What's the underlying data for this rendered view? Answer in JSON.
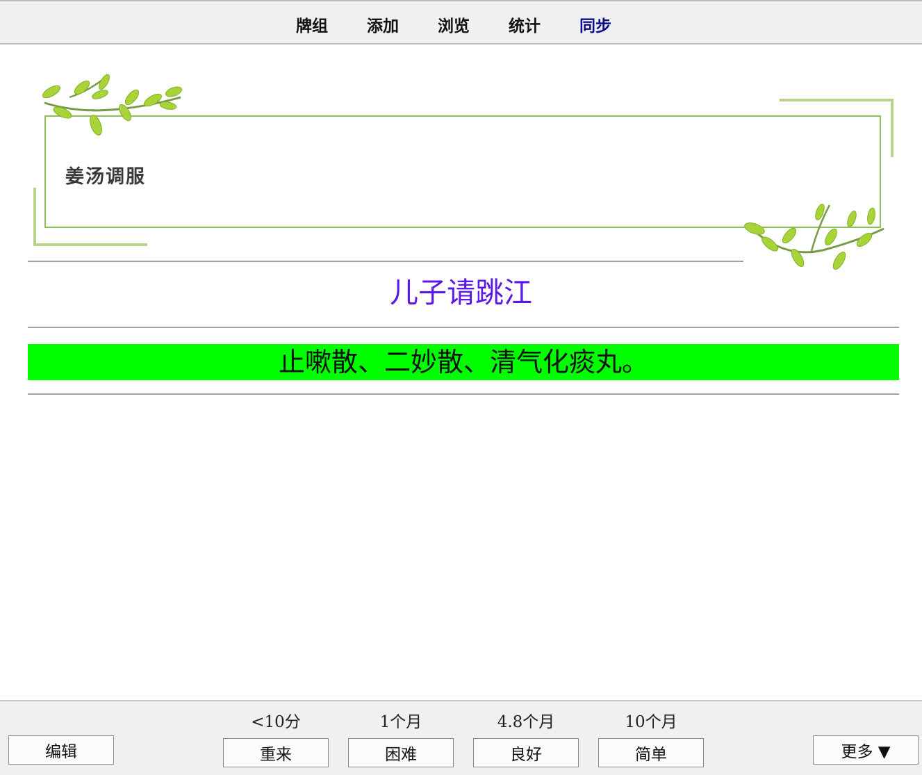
{
  "topbar": {
    "items": [
      "牌组",
      "添加",
      "浏览",
      "统计",
      "同步"
    ]
  },
  "card": {
    "front_text": "姜汤调服",
    "answer_title": "儿子请跳江",
    "answer_text": "止嗽散、二妙散、清气化痰丸。"
  },
  "bottombar": {
    "edit_label": "编辑",
    "more_label": "更多 ▼",
    "intervals": [
      "<10分",
      "1个月",
      "4.8个月",
      "10个月"
    ],
    "answers": [
      "重来",
      "困难",
      "良好",
      "简单"
    ]
  },
  "colors": {
    "frame_border": "#8cbe5a",
    "answer_title": "#5a17e8",
    "answer_highlight": "#00ff00",
    "active_nav": "#0a0a8a"
  }
}
